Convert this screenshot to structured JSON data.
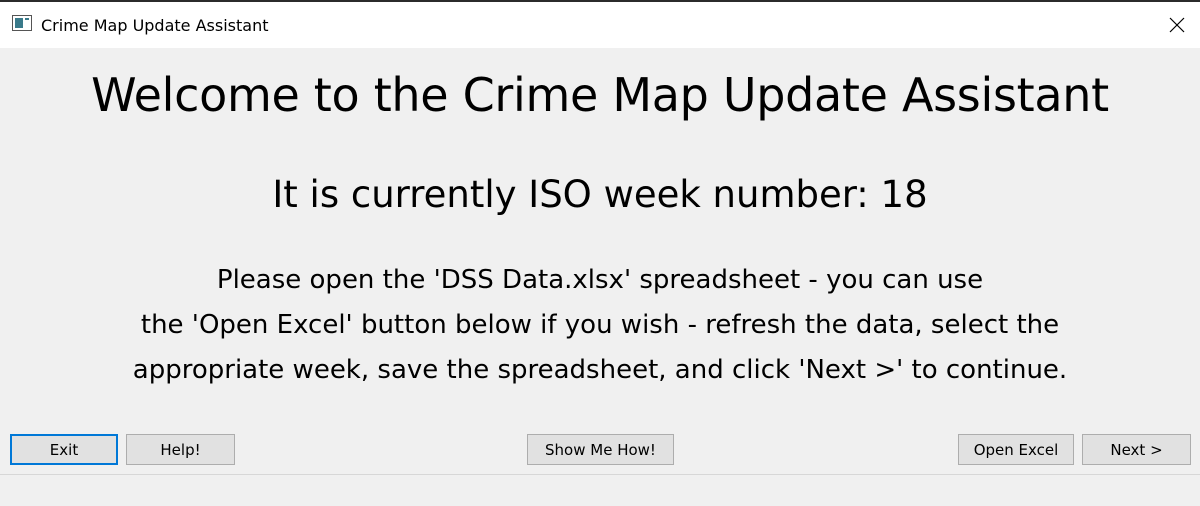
{
  "window": {
    "title": "Crime Map Update Assistant",
    "icon": "app-window-icon",
    "close_icon": "close-icon"
  },
  "main": {
    "heading": "Welcome to the Crime Map Update Assistant",
    "week_line": "It is currently ISO week number: 18",
    "instructions": [
      "Please open the 'DSS Data.xlsx' spreadsheet - you can use",
      "the 'Open Excel' button below if you wish - refresh the data, select the",
      "appropriate week, save the spreadsheet, and click 'Next >' to continue."
    ]
  },
  "buttons": {
    "exit": "Exit",
    "help": "Help!",
    "show_me_how": "Show Me How!",
    "open_excel": "Open Excel",
    "next": "Next >"
  },
  "colors": {
    "focus_border": "#0078d7",
    "background": "#f0f0f0",
    "titlebar": "#ffffff"
  }
}
